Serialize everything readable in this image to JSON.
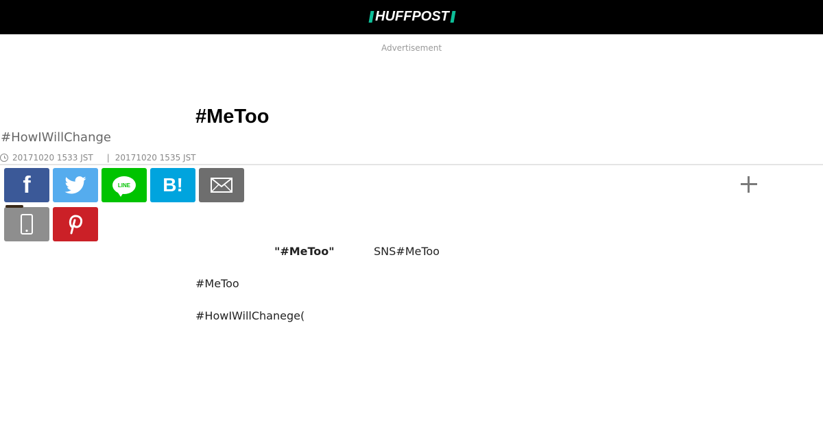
{
  "header": {
    "logo_text": "HUFFPOST",
    "logo_accent_color": "#0dbe98",
    "background_color": "#000000"
  },
  "ad": {
    "label": "Advertisement"
  },
  "article": {
    "section_tag": "",
    "headline": "#MeToo",
    "subheadline": "#HowIWillChange",
    "published": "20171020 1533 JST",
    "updated": "20171020 1535 JST",
    "separator": "|",
    "paragraphs": {
      "p1_bold": "\"#MeToo\"",
      "p1_rest": "SNS#MeToo",
      "p2": "#MeToo",
      "p3": "#HowIWillChanege("
    }
  },
  "share": {
    "buttons": [
      {
        "name": "facebook",
        "icon": "facebook-icon",
        "color": "#3b5998"
      },
      {
        "name": "twitter",
        "icon": "twitter-icon",
        "color": "#55acee"
      },
      {
        "name": "line",
        "icon": "line-icon",
        "label": "LINE",
        "color": "#00c300"
      },
      {
        "name": "hatena",
        "icon": "hatena-bookmark-icon",
        "label": "B!",
        "color": "#00a4de"
      },
      {
        "name": "email",
        "icon": "mail-icon",
        "color": "#6e6e6e"
      },
      {
        "name": "mobile",
        "icon": "mobile-icon",
        "color": "#8e8e8e"
      },
      {
        "name": "pinterest",
        "icon": "pinterest-icon",
        "color": "#cb2027"
      }
    ],
    "more_icon": "plus-icon",
    "fb_glyph": "f"
  }
}
